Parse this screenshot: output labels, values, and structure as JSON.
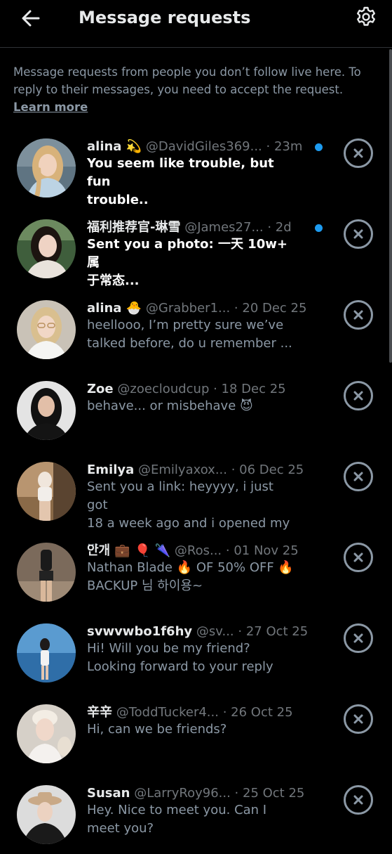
{
  "header": {
    "title": "Message requests",
    "back_icon": "arrow-left-icon",
    "settings_icon": "gear-icon"
  },
  "intro": {
    "text": "Message requests from people you don’t follow live here. To reply to their messages, you need to accept the request.",
    "learn_more": "Learn more"
  },
  "colors": {
    "background": "#000000",
    "primary_text": "#e7e9ea",
    "secondary_text": "#71767b",
    "unread_dot": "#1d9bf0"
  },
  "requests": [
    {
      "name": "alina 💫",
      "handle": "@DavidGiles369...",
      "time": " · 23m",
      "preview": "You seem like trouble, but fun\ntrouble..",
      "unread": true
    },
    {
      "name": "福利推荐官-琳雪",
      "handle": "@James27...",
      "time": "  · 2d",
      "preview": "Sent you a photo: 一天 10w+ 属\n于常态...",
      "unread": true
    },
    {
      "name": "alina 🐣",
      "handle": "@Grabber1...",
      "time": " · 20 Dec 25",
      "preview": "heellooo, I’m pretty sure we’ve\ntalked before, do u remember ...",
      "unread": false
    },
    {
      "name": "Zoe",
      "handle": "@zoecloudcup",
      "time": " · 18 Dec 25",
      "preview": "behave... or misbehave 😈",
      "unread": false
    },
    {
      "name": "Emilya",
      "handle": "@Emilyaxox...",
      "time": " · 06 Dec 25",
      "preview": "Sent you a link: heyyyy, i just got\n18 a week ago and i opened my ...",
      "unread": false
    },
    {
      "name": "안개 💼 🎈 🌂",
      "handle": "@Ros...",
      "time": " · 01 Nov 25",
      "preview": "Nathan Blade 🔥 OF 50% OFF 🔥\nBACKUP 님 하이용~",
      "unread": false
    },
    {
      "name": "svwvwbo1f6hy",
      "handle": "@sv...",
      "time": "  · 27 Oct 25",
      "preview": "Hi! Will you be my friend?\nLooking forward to your reply",
      "unread": false
    },
    {
      "name": "辛辛",
      "handle": "@ToddTucker4...",
      "time": "  · 26 Oct 25",
      "preview": "Hi, can we be friends?",
      "unread": false
    },
    {
      "name": "Susan",
      "handle": "@LarryRoy96...",
      "time": "  · 25 Oct 25",
      "preview": "Hey. Nice to meet you. Can I\nmeet you?",
      "unread": false
    }
  ]
}
